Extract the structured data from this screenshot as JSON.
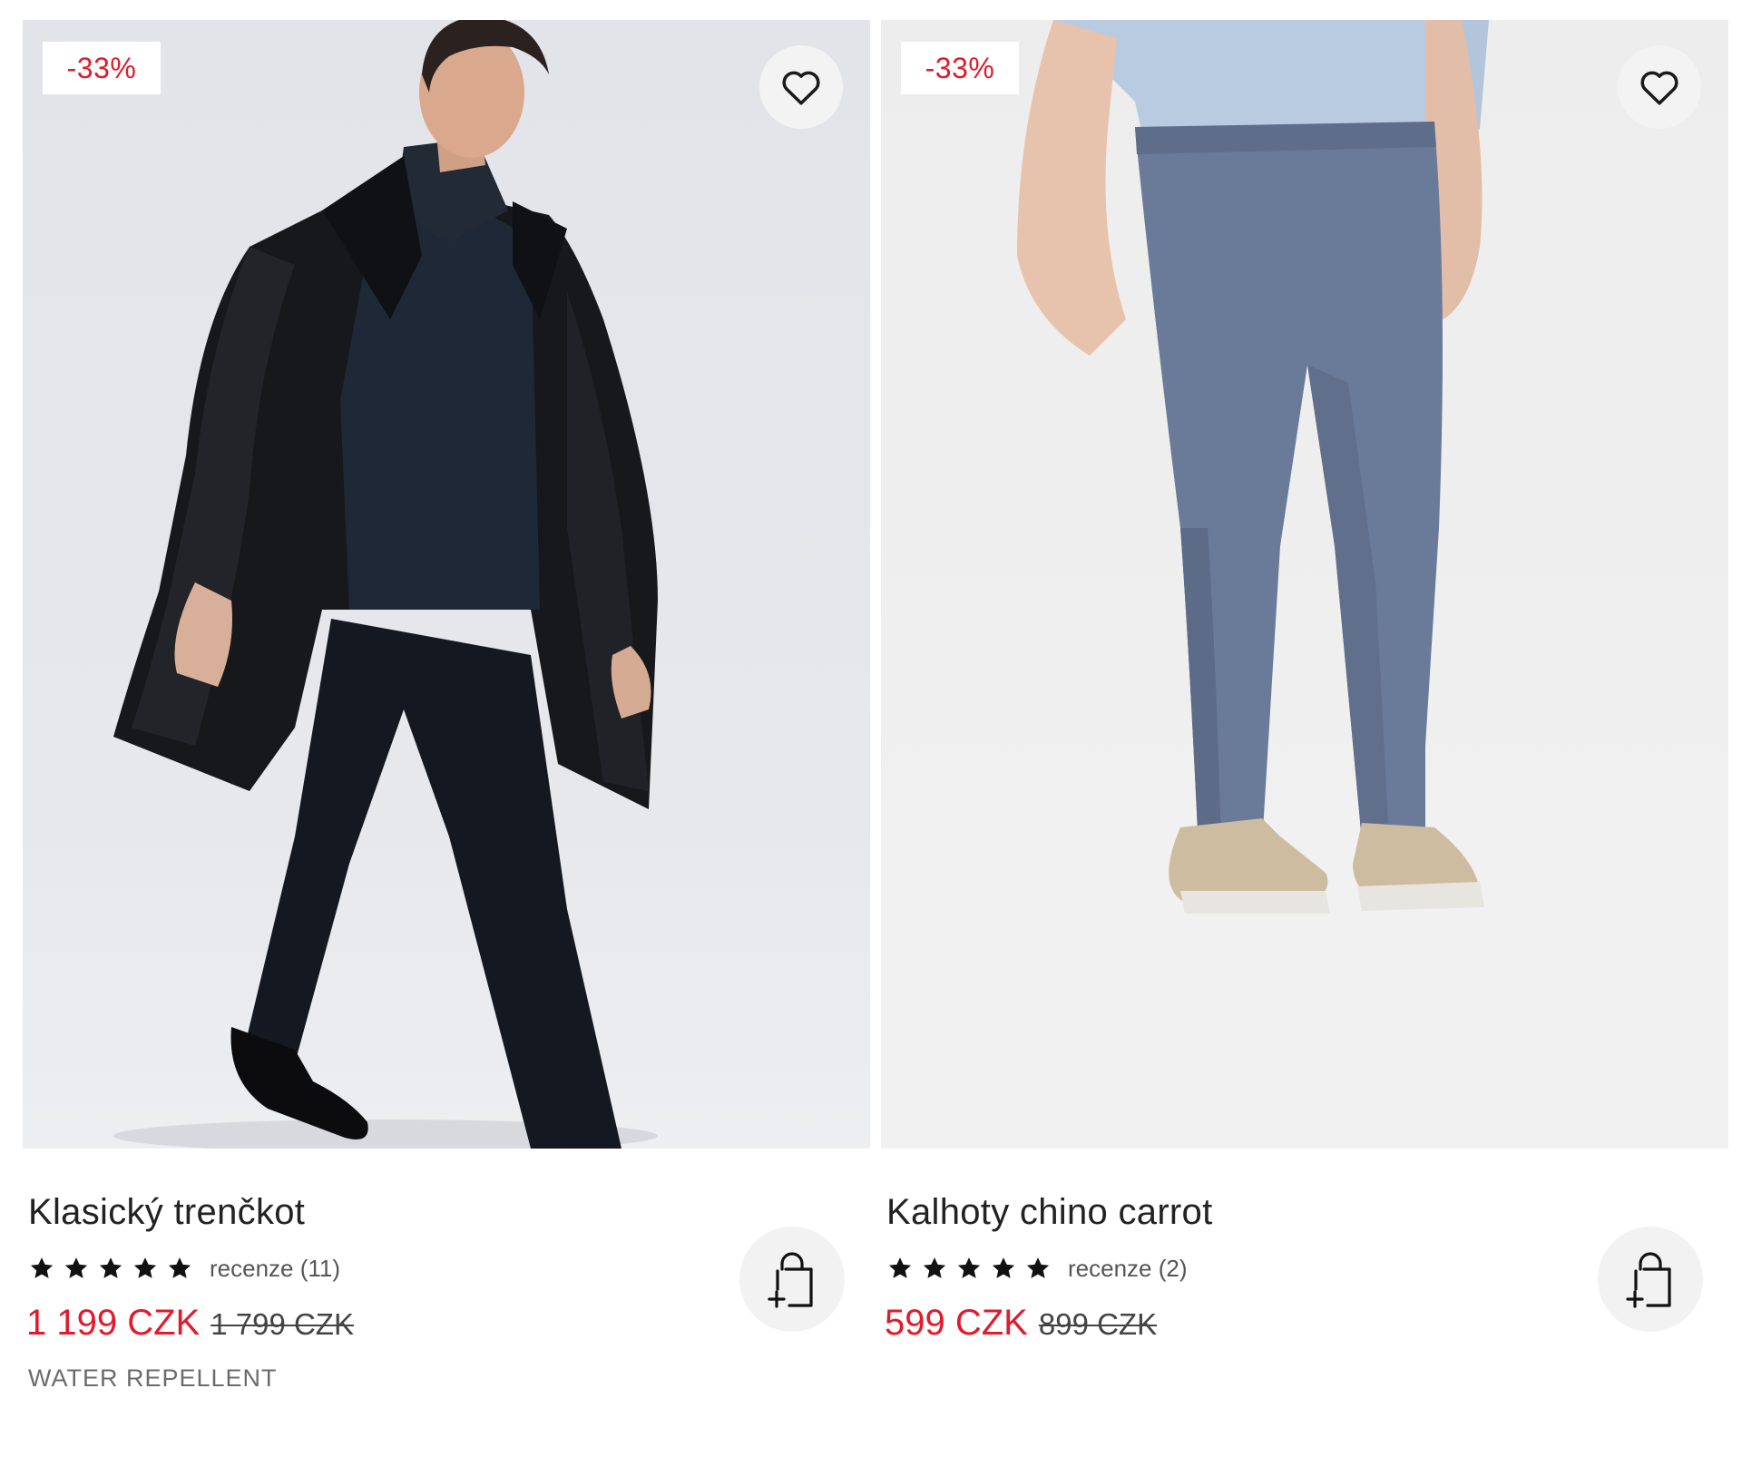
{
  "colors": {
    "sale_red": "#e11b2b",
    "text_dark": "#222222",
    "muted": "#6b6b6b"
  },
  "products": [
    {
      "discount_badge": "-33%",
      "name": "Klasický trenčkot",
      "rating_stars": 5,
      "reviews_text": "recenze (11)",
      "price_current": "1 199 CZK",
      "price_original": "1 799 CZK",
      "feature": "WATER REPELLENT",
      "wishlist_icon": "heart-outline-icon",
      "cart_icon": "add-to-bag-icon"
    },
    {
      "discount_badge": "-33%",
      "name": "Kalhoty chino carrot",
      "rating_stars": 5,
      "reviews_text": "recenze (2)",
      "price_current": "599 CZK",
      "price_original": "899 CZK",
      "wishlist_icon": "heart-outline-icon",
      "cart_icon": "add-to-bag-icon"
    }
  ]
}
